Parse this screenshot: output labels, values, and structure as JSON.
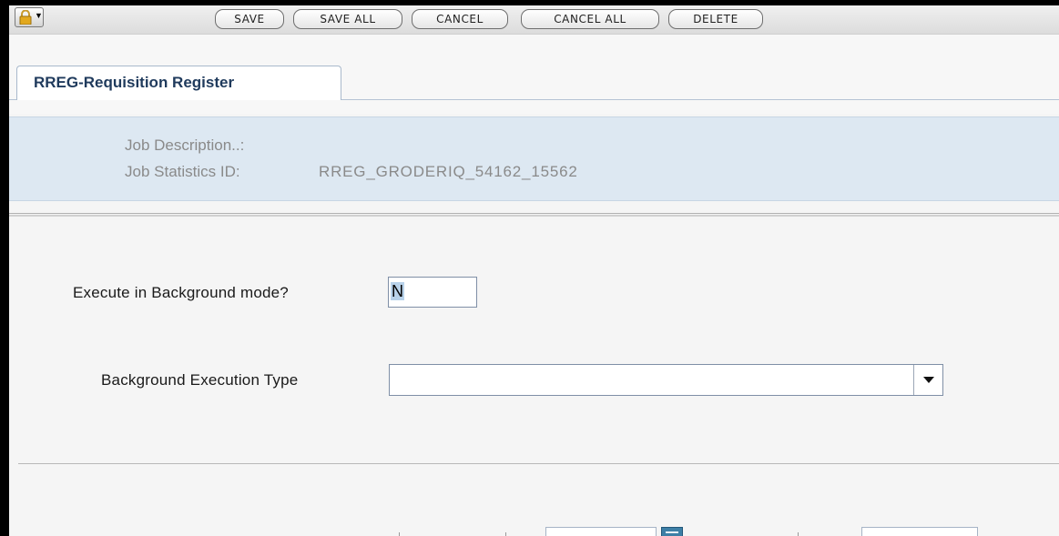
{
  "toolbar": {
    "lock_icon": "lock-icon",
    "buttons": [
      {
        "label": "SAVE"
      },
      {
        "label": "SAVE ALL"
      },
      {
        "label": "CANCEL"
      },
      {
        "label": "CANCEL ALL"
      },
      {
        "label": "DELETE"
      }
    ]
  },
  "tab": {
    "label": "RREG-Requisition Register"
  },
  "info": {
    "job_description_label": "Job Description..:",
    "job_description_value": "",
    "job_stats_label": "Job Statistics ID:",
    "job_stats_value": "RREG_GRODERIQ_54162_15562"
  },
  "form": {
    "background_mode_label": "Execute in Background mode?",
    "background_mode_value": "N",
    "execution_type_label": "Background Execution Type",
    "execution_type_value": ""
  },
  "colors": {
    "info_band": "#dde8f2",
    "tab_text": "#1f3a5c",
    "calendar_icon": "#3d7fa6"
  }
}
